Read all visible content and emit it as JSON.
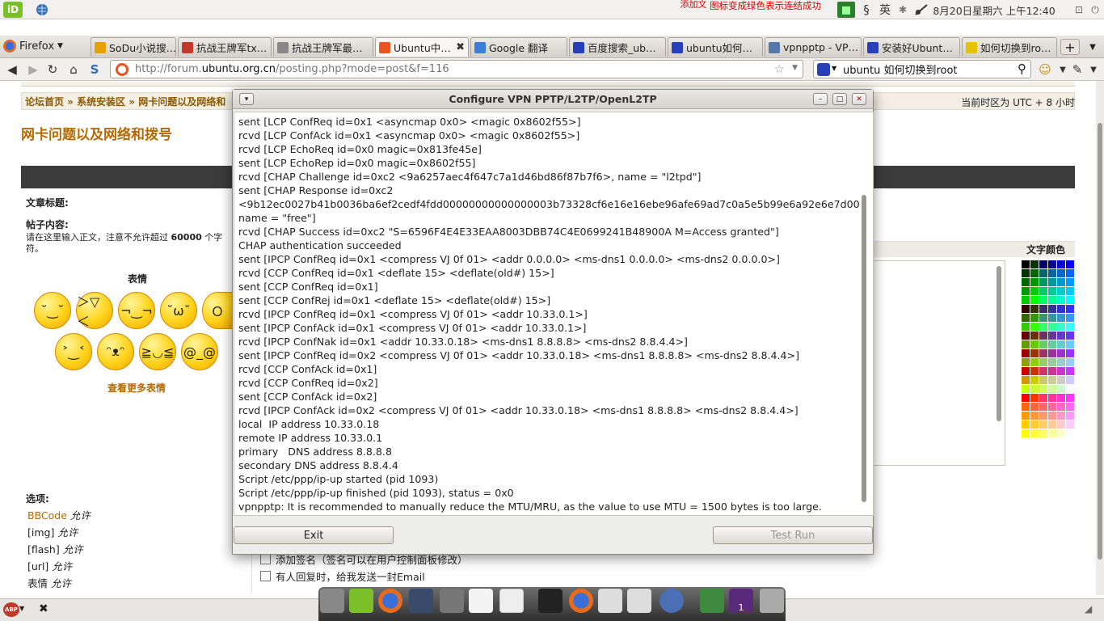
{
  "topbar": {
    "notice": "图标变成绿色表示连结成功",
    "notice_prefix": "添加文",
    "ime": "英",
    "clock": "8月20日星期六 上午12:40"
  },
  "browser": {
    "menu_label": "Firefox",
    "tabs": [
      {
        "label": "SoDu小说搜…",
        "color": "#e6a100"
      },
      {
        "label": "抗战王牌军tx…",
        "color": "#c0392b"
      },
      {
        "label": "抗战王牌军最…",
        "color": "#888"
      },
      {
        "label": "Ubuntu中…",
        "color": "#e95420",
        "active": true
      },
      {
        "label": "Google 翻译",
        "color": "#3b7dd8"
      },
      {
        "label": "百度搜索_ub…",
        "color": "#2740b8"
      },
      {
        "label": "ubuntu如何…",
        "color": "#2740b8"
      },
      {
        "label": "vpnpptp - VP…",
        "color": "#5577aa"
      },
      {
        "label": "安装好Ubunt…",
        "color": "#2740b8"
      },
      {
        "label": "如何切换到ro…",
        "color": "#e6c200"
      }
    ],
    "url_pre": "http://forum.",
    "url_host": "ubuntu.org.cn",
    "url_post": "/posting.php?mode=post&f=116",
    "search_value": "ubuntu 如何切换到root"
  },
  "forum": {
    "breadcrumb": "论坛首页 » 系统安装区 » 网卡问题以及网络和",
    "timezone": "当前时区为 UTC + 8 小时",
    "forum_title": "网卡问题以及网络和拨号",
    "subject_label": "文章标题:",
    "body_label": "帖子内容:",
    "body_hint_1": "请在这里输入正文，注意不允许超过",
    "body_hint_num": "60000",
    "body_hint_2": "个字",
    "body_hint_3": "符。",
    "smilies_label": "表情",
    "more_smilies": "查看更多表情",
    "text_color_label": "文字颜色",
    "options_label": "选项:",
    "opt_bbcode": "BBCode",
    "opt_allowed": "允许",
    "opt_img": "[img]",
    "opt_flash": "[flash]",
    "opt_url": "[url]",
    "opt_smilies": "表情",
    "chk_signature": "添加签名（签名可以在用户控制面板修改）",
    "chk_notify": "有人回复时，给我发送一封Email"
  },
  "dialog": {
    "title": "Configure VPN PPTP/L2TP/OpenL2TP",
    "exit_label": "Exit",
    "test_run_label": "Test Run",
    "log": [
      "sent [LCP ConfReq id=0x1 <asyncmap 0x0> <magic 0x8602f55>]",
      "rcvd [LCP ConfAck id=0x1 <asyncmap 0x0> <magic 0x8602f55>]",
      "rcvd [LCP EchoReq id=0x0 magic=0x813fe45e]",
      "sent [LCP EchoRep id=0x0 magic=0x8602f55]",
      "rcvd [CHAP Challenge id=0xc2 <9a6257aec4f647c7a1d46bd86f87b7f6>, name = \"l2tpd\"]",
      "sent [CHAP Response id=0xc2",
      "<9b12ec0027b41b0036ba6ef2cedf4fdd00000000000000003b73328cf6e16e16ebe96afe69ad7c0a5e5b99e6a92e6e7d00",
      "name = \"free\"]",
      "rcvd [CHAP Success id=0xc2 \"S=6596F4E4E33EAA8003DBB74C4E0699241B48900A M=Access granted\"]",
      "CHAP authentication succeeded",
      "sent [IPCP ConfReq id=0x1 <compress VJ 0f 01> <addr 0.0.0.0> <ms-dns1 0.0.0.0> <ms-dns2 0.0.0.0>]",
      "rcvd [CCP ConfReq id=0x1 <deflate 15> <deflate(old#) 15>]",
      "sent [CCP ConfReq id=0x1]",
      "sent [CCP ConfRej id=0x1 <deflate 15> <deflate(old#) 15>]",
      "rcvd [IPCP ConfReq id=0x1 <compress VJ 0f 01> <addr 10.33.0.1>]",
      "sent [IPCP ConfAck id=0x1 <compress VJ 0f 01> <addr 10.33.0.1>]",
      "rcvd [IPCP ConfNak id=0x1 <addr 10.33.0.18> <ms-dns1 8.8.8.8> <ms-dns2 8.8.4.4>]",
      "sent [IPCP ConfReq id=0x2 <compress VJ 0f 01> <addr 10.33.0.18> <ms-dns1 8.8.8.8> <ms-dns2 8.8.4.4>]",
      "rcvd [CCP ConfAck id=0x1]",
      "rcvd [CCP ConfReq id=0x2]",
      "sent [CCP ConfAck id=0x2]",
      "rcvd [IPCP ConfAck id=0x2 <compress VJ 0f 01> <addr 10.33.0.18> <ms-dns1 8.8.8.8> <ms-dns2 8.8.4.4>]",
      "local  IP address 10.33.0.18",
      "remote IP address 10.33.0.1",
      "primary   DNS address 8.8.8.8",
      "secondary DNS address 8.8.4.4",
      "Script /etc/ppp/ip-up started (pid 1093)",
      "Script /etc/ppp/ip-up finished (pid 1093), status = 0x0",
      "vpnpptp: It is recommended to manually reduce the MTU/MRU, as the value to use MTU = 1500 bytes is too large."
    ]
  },
  "taskbar": {
    "abp": "ABP",
    "dock_badge": "1"
  },
  "palette": [
    "#000000",
    "#003300",
    "#000066",
    "#000099",
    "#0000cc",
    "#0000ff",
    "#003300",
    "#006600",
    "#006666",
    "#006699",
    "#0066cc",
    "#0066ff",
    "#006600",
    "#009900",
    "#009966",
    "#009999",
    "#0099cc",
    "#0099ff",
    "#009900",
    "#00cc00",
    "#00cc66",
    "#00cc99",
    "#00cccc",
    "#00ccff",
    "#00cc00",
    "#00ff00",
    "#00ff66",
    "#00ff99",
    "#00ffcc",
    "#00ffff",
    "#330000",
    "#333300",
    "#333366",
    "#333399",
    "#3333cc",
    "#3333ff",
    "#336600",
    "#339900",
    "#339966",
    "#339999",
    "#3399cc",
    "#3399ff",
    "#33cc00",
    "#33ff00",
    "#33ff66",
    "#33ff99",
    "#33ffcc",
    "#33ffff",
    "#660000",
    "#663300",
    "#663366",
    "#663399",
    "#6633cc",
    "#6633ff",
    "#669900",
    "#66cc00",
    "#66cc66",
    "#66cc99",
    "#66cccc",
    "#66ccff",
    "#990000",
    "#993300",
    "#993366",
    "#993399",
    "#9933cc",
    "#9933ff",
    "#999900",
    "#99cc00",
    "#99cc66",
    "#99cc99",
    "#99cccc",
    "#99ccff",
    "#cc0000",
    "#cc3300",
    "#cc3366",
    "#cc3399",
    "#cc33cc",
    "#cc33ff",
    "#cc9900",
    "#cccc00",
    "#cccc66",
    "#cccc99",
    "#cccccc",
    "#ccccff",
    "#ccff00",
    "#ccff33",
    "#ccff66",
    "#ccff99",
    "#ccffcc",
    "#ffffff",
    "#ff0000",
    "#ff3300",
    "#ff3366",
    "#ff3399",
    "#ff33cc",
    "#ff33ff",
    "#ff6600",
    "#ff6633",
    "#ff6666",
    "#ff6699",
    "#ff66cc",
    "#ff66ff",
    "#ff9900",
    "#ff9933",
    "#ff9966",
    "#ff9999",
    "#ff99cc",
    "#ff99ff",
    "#ffcc00",
    "#ffcc33",
    "#ffcc66",
    "#ffcc99",
    "#ffcccc",
    "#ffccff",
    "#ffff00",
    "#ffff33",
    "#ffff66",
    "#ffff99",
    "#ffffcc",
    "#ffffff"
  ]
}
